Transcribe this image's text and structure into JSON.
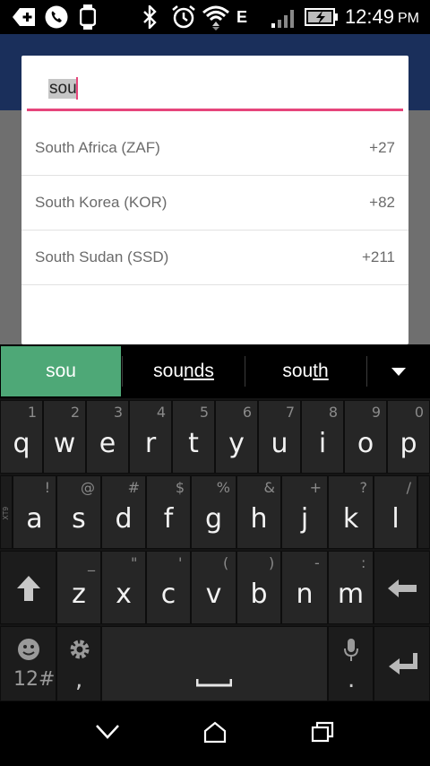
{
  "status_bar": {
    "time": "12:49",
    "ampm": "PM",
    "network_type": "E",
    "icons": [
      "add-notification-icon",
      "phone-icon",
      "watch-icon",
      "bluetooth-icon",
      "alarm-icon",
      "wifi-icon",
      "signal-icon",
      "battery-charging-icon"
    ]
  },
  "dialog": {
    "search_value": "sou",
    "results": [
      {
        "name": "South Africa (ZAF)",
        "code": "+27"
      },
      {
        "name": "South Korea (KOR)",
        "code": "+82"
      },
      {
        "name": "South Sudan (SSD)",
        "code": "+211"
      }
    ]
  },
  "suggestions": {
    "selected": "sou",
    "items": [
      {
        "prefix": "sou",
        "suffix": "nds"
      },
      {
        "prefix": "sou",
        "suffix": "th"
      }
    ],
    "more_icon": "triangle-down-icon"
  },
  "keyboard": {
    "row1": [
      {
        "key": "q",
        "hint": "1"
      },
      {
        "key": "w",
        "hint": "2"
      },
      {
        "key": "e",
        "hint": "3"
      },
      {
        "key": "r",
        "hint": "4"
      },
      {
        "key": "t",
        "hint": "5"
      },
      {
        "key": "y",
        "hint": "6"
      },
      {
        "key": "u",
        "hint": "7"
      },
      {
        "key": "i",
        "hint": "8"
      },
      {
        "key": "o",
        "hint": "9"
      },
      {
        "key": "p",
        "hint": "0"
      }
    ],
    "row2": [
      {
        "key": "a",
        "hint": "!"
      },
      {
        "key": "s",
        "hint": "@"
      },
      {
        "key": "d",
        "hint": "#"
      },
      {
        "key": "f",
        "hint": "$"
      },
      {
        "key": "g",
        "hint": "%"
      },
      {
        "key": "h",
        "hint": "&"
      },
      {
        "key": "j",
        "hint": "+"
      },
      {
        "key": "k",
        "hint": "?"
      },
      {
        "key": "l",
        "hint": "/"
      }
    ],
    "row2_side_label": "XT9",
    "row3": [
      {
        "key": "z",
        "hint": "_"
      },
      {
        "key": "x",
        "hint": "\""
      },
      {
        "key": "c",
        "hint": "'"
      },
      {
        "key": "v",
        "hint": "("
      },
      {
        "key": "b",
        "hint": ")"
      },
      {
        "key": "n",
        "hint": "-"
      },
      {
        "key": "m",
        "hint": ":"
      }
    ],
    "numbers_key": "12#",
    "comma_key": ",",
    "period_key": ".",
    "icons": {
      "shift": "shift-arrow-icon",
      "backspace": "backspace-icon",
      "emoji": "emoji-icon",
      "settings": "gear-icon",
      "space": "space-bar-icon",
      "mic": "microphone-icon",
      "enter": "enter-icon"
    }
  },
  "nav_bar": {
    "icons": [
      "back-chevron-icon",
      "home-icon",
      "recent-apps-icon"
    ]
  },
  "colors": {
    "accent_pink": "#e6457b",
    "suggestion_green": "#4ea877",
    "app_bar": "#1a2f5b"
  }
}
